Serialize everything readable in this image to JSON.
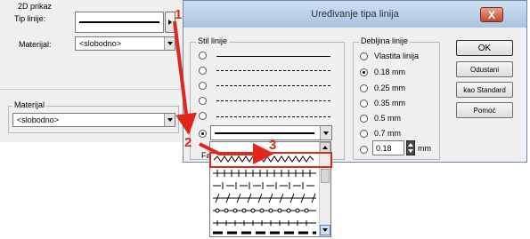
{
  "left_panel": {
    "section_title": "2D prikaz",
    "tip_linije_label": "Tip linije:",
    "materijal_label": "Materijal:",
    "materijal_value": "<slobodno>",
    "materijal_group_title": "Materijal",
    "materijal_group_value": "<slobodno>"
  },
  "dialog": {
    "title": "Uređivanje tipa linija",
    "close_label": "X",
    "stil_linije": {
      "title": "Stil linije",
      "partial_label": "Fa"
    },
    "debljina": {
      "title": "Debljina linije",
      "options": [
        "Vlastita linija",
        "0.18 mm",
        "0.25 mm",
        "0.35 mm",
        "0.5 mm",
        "0.7 mm"
      ],
      "selected": "0.18 mm",
      "custom_value": "0.18",
      "custom_unit": "mm"
    },
    "buttons": {
      "ok": "OK",
      "cancel": "Odustani",
      "standard": "kao Standard",
      "help": "Pomoć"
    }
  },
  "annotations": {
    "step1": "1",
    "step2": "2",
    "step3": "3"
  },
  "colors": {
    "annotation": "#e1261c",
    "title_bar": "#b9cfe8"
  }
}
